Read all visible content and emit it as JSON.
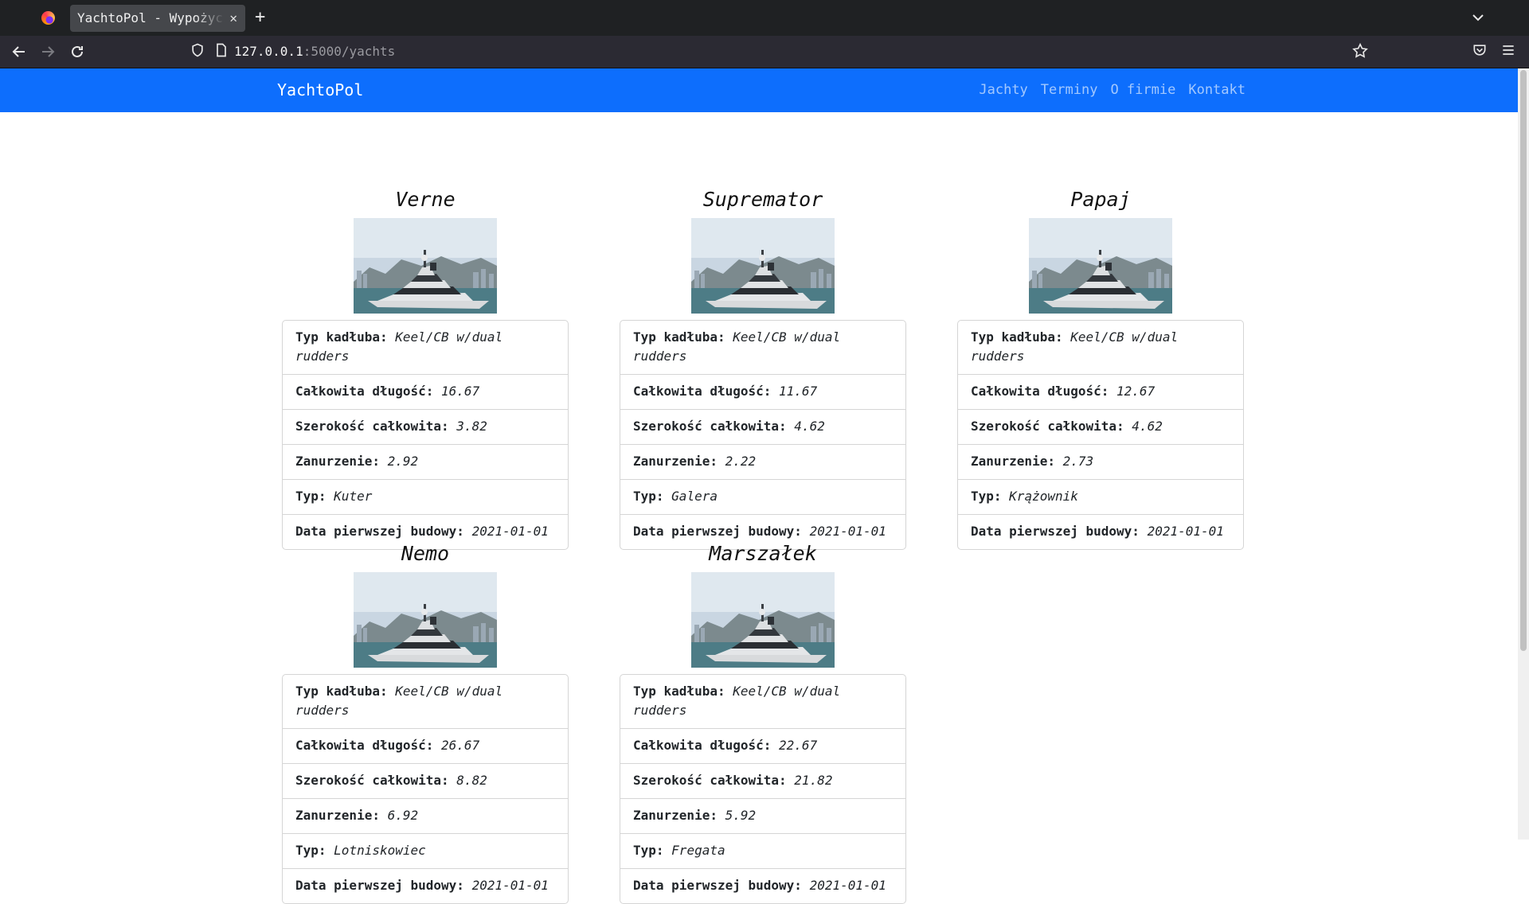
{
  "browser": {
    "tab_title": "YachtoPol - Wypożyczalnia",
    "url_host": "127.0.0.1",
    "url_rest": ":5000/yachts"
  },
  "site": {
    "brand": "YachtoPol",
    "nav": [
      "Jachty",
      "Terminy",
      "O firmie",
      "Kontakt"
    ]
  },
  "labels": {
    "hull": "Typ kadłuba:",
    "length": "Całkowita długość:",
    "beam": "Szerokość całkowita:",
    "draft": "Zanurzenie:",
    "type": "Typ:",
    "built": "Data pierwszej budowy:"
  },
  "yachts": [
    {
      "name": "Verne",
      "hull": "Keel/CB w/dual rudders",
      "length": "16.67",
      "beam": "3.82",
      "draft": "2.92",
      "type": "Kuter",
      "built": "2021-01-01"
    },
    {
      "name": "Supremator",
      "hull": "Keel/CB w/dual rudders",
      "length": "11.67",
      "beam": "4.62",
      "draft": "2.22",
      "type": "Galera",
      "built": "2021-01-01"
    },
    {
      "name": "Papaj",
      "hull": "Keel/CB w/dual rudders",
      "length": "12.67",
      "beam": "4.62",
      "draft": "2.73",
      "type": "Krążownik",
      "built": "2021-01-01"
    },
    {
      "name": "Nemo",
      "hull": "Keel/CB w/dual rudders",
      "length": "26.67",
      "beam": "8.82",
      "draft": "6.92",
      "type": "Lotniskowiec",
      "built": "2021-01-01"
    },
    {
      "name": "Marszałek",
      "hull": "Keel/CB w/dual rudders",
      "length": "22.67",
      "beam": "21.82",
      "draft": "5.92",
      "type": "Fregata",
      "built": "2021-01-01"
    }
  ]
}
